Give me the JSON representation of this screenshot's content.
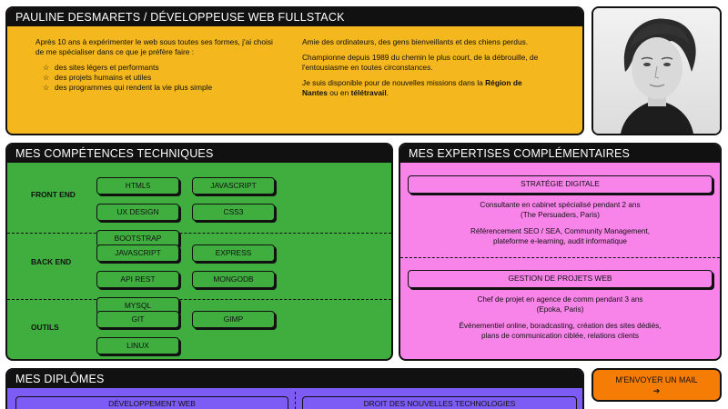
{
  "intro": {
    "title": "PAULINE DESMARETS / DÉVELOPPEUSE WEB FULLSTACK",
    "left_paragraph": "Après 10 ans à expérimenter le web sous toutes ses formes, j'ai choisi de me spécialiser dans ce que je préfère faire :",
    "bullets": [
      "des sites légers et performants",
      "des projets humains et utiles",
      "des programmes qui rendent la vie plus simple"
    ],
    "right_p1": "Amie des ordinateurs, des gens bienveillants et des chiens perdus.",
    "right_p2": "Championne depuis 1989 du chemin le plus court, de la débrouille, de l'entousiasme en toutes circonstances.",
    "right_p3_before": "Je suis disponible pour de nouvelles missions dans la ",
    "right_p3_region": "Région de Nantes",
    "right_p3_mid": " ou en ",
    "right_p3_remote": "télétravail",
    "right_p3_end": ".",
    "bullet_icon": "star-outline-icon"
  },
  "skills": {
    "title": "MES COMPÉTENCES TECHNIQUES",
    "rows": [
      {
        "category": "FRONT END",
        "tags": [
          "HTML5",
          "JAVASCRIPT",
          "UX DESIGN",
          "CSS3",
          "BOOTSTRAP"
        ]
      },
      {
        "category": "BACK END",
        "tags": [
          "JAVASCRIPT",
          "EXPRESS",
          "API REST",
          "MONGODB",
          "MYSQL"
        ]
      },
      {
        "category": "OUTILS",
        "tags": [
          "GIT",
          "GIMP",
          "LINUX"
        ]
      }
    ]
  },
  "expertise": {
    "title": "MES EXPERTISES COMPLÉMENTAIRES",
    "blocks": [
      {
        "heading": "STRATÉGIE DIGITALE",
        "p1_line1": "Consultante en cabinet spécialisé pendant 2 ans",
        "p1_line2": "(The Persuaders, Paris)",
        "p2_line1": "Référencement SEO / SEA, Community Management,",
        "p2_line2": "plateforme e-learning, audit informatique"
      },
      {
        "heading": "GESTION DE PROJETS WEB",
        "p1_line1": "Chef de projet en agence de comm pendant 3 ans",
        "p1_line2": "(Epoka, Paris)",
        "p2_line1": "Événementiel online, boradcasting, création des sites dédiés,",
        "p2_line2": "plans de communication ciblée, relations clients"
      }
    ]
  },
  "diplomes": {
    "title": "MES DIPLÔMES",
    "items": [
      "DÉVELOPPEMENT WEB",
      "DROIT DES NOUVELLES TECHNOLOGIES"
    ]
  },
  "mail_button": {
    "label": "M'ENVOYER UN MAIL",
    "arrow": "➔"
  },
  "colors": {
    "intro": "#f4b71d",
    "skills": "#3fae3f",
    "expertise": "#f884ea",
    "diplomes": "#7c5cf4",
    "mail": "#f57c05"
  }
}
